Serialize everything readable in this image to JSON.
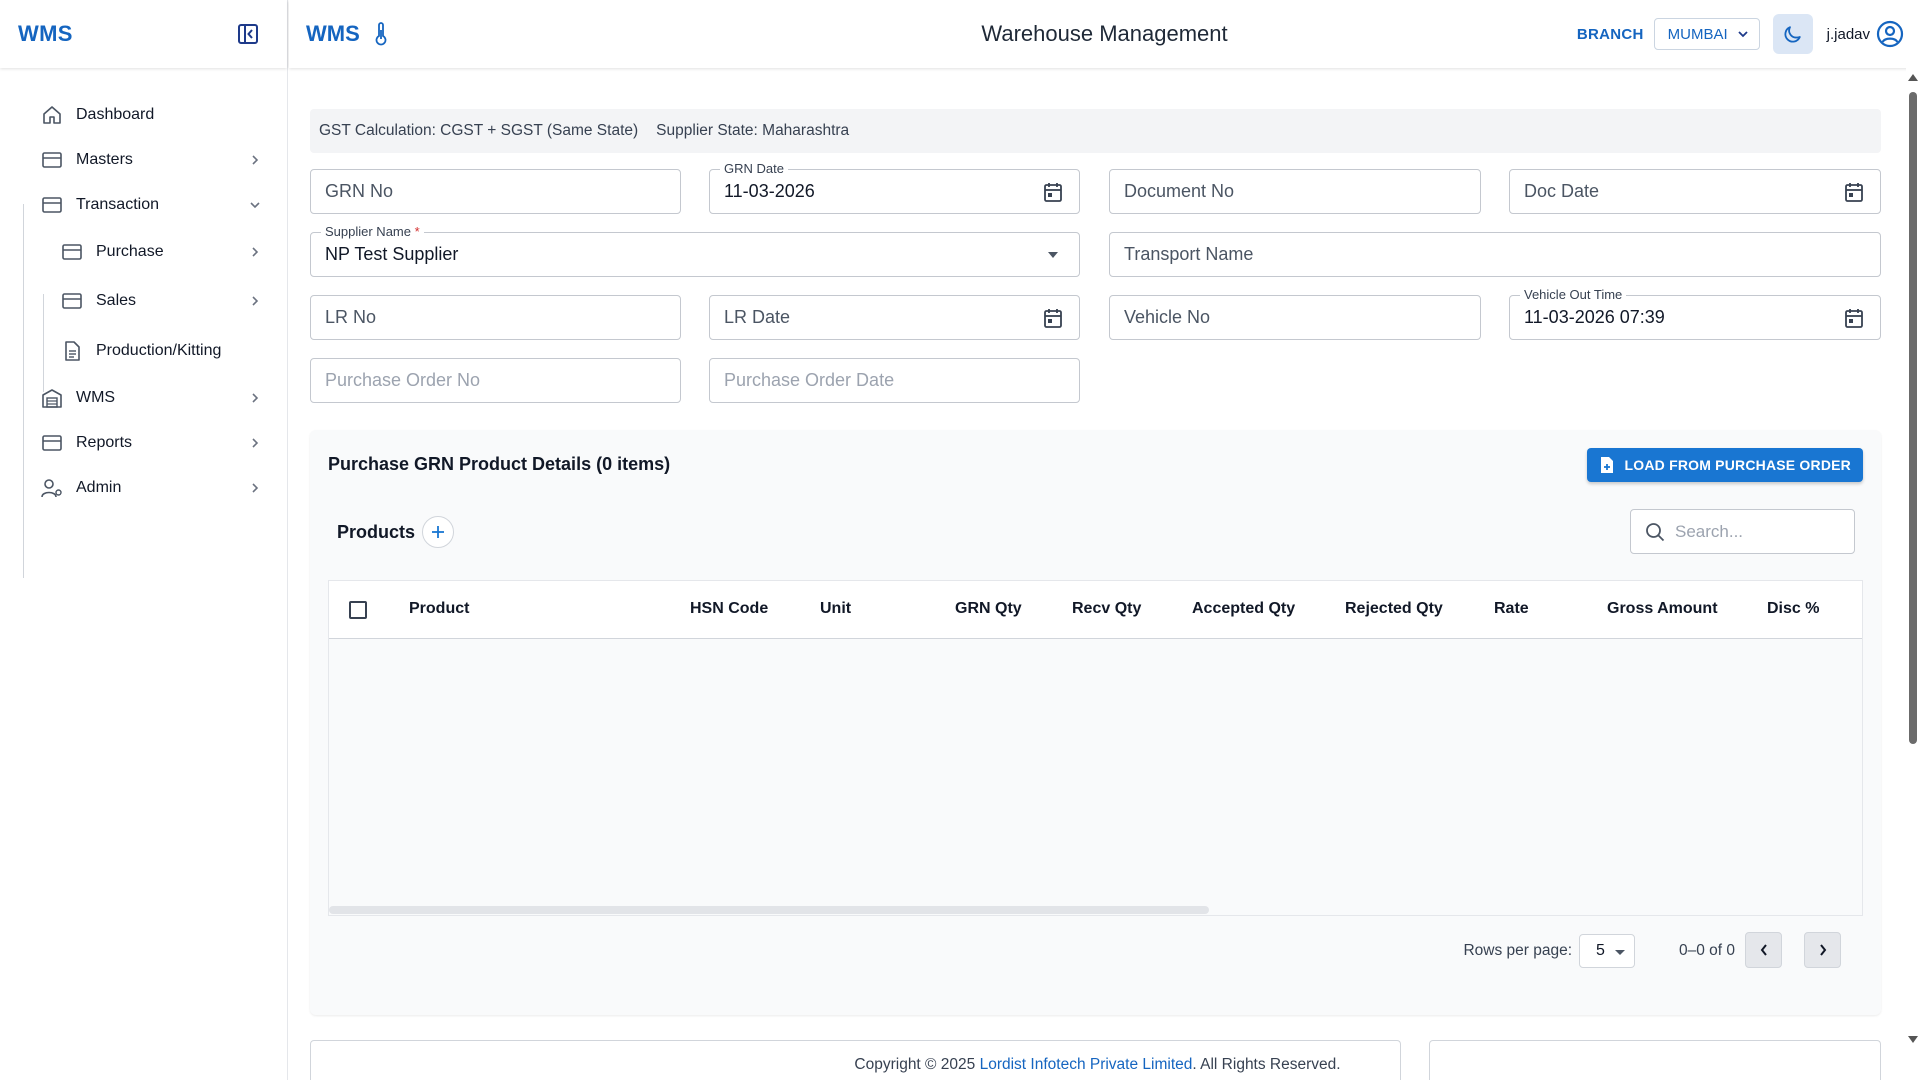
{
  "app": {
    "sidebar_logo": "WMS",
    "topbar_logo": "WMS",
    "page_title": "Warehouse Management",
    "branch_label": "BRANCH",
    "branch_value": "MUMBAI",
    "username": "j.jadav",
    "accent_color": "#1565c0"
  },
  "sidebar": {
    "items": [
      {
        "label": "Dashboard",
        "icon": "home-icon"
      },
      {
        "label": "Masters",
        "icon": "card-icon"
      },
      {
        "label": "Transaction",
        "icon": "card-icon"
      },
      {
        "label": "Purchase",
        "icon": "card-icon"
      },
      {
        "label": "Sales",
        "icon": "card-icon"
      },
      {
        "label": "Production/Kitting",
        "icon": "document-icon"
      },
      {
        "label": "WMS",
        "icon": "warehouse-icon"
      },
      {
        "label": "Reports",
        "icon": "card-icon"
      },
      {
        "label": "Admin",
        "icon": "user-gear-icon"
      }
    ]
  },
  "gst": {
    "calculation": "GST Calculation: CGST + SGST (Same State)",
    "supplier_state": "Supplier State: Maharashtra"
  },
  "form": {
    "grn_no": {
      "placeholder": "GRN No"
    },
    "grn_date": {
      "label": "GRN Date",
      "value": "11-03-2026"
    },
    "document_no": {
      "placeholder": "Document No"
    },
    "doc_date": {
      "placeholder": "Doc Date"
    },
    "supplier_name": {
      "label": "Supplier Name",
      "required_mark": "*",
      "value": "NP Test Supplier"
    },
    "transport_name": {
      "placeholder": "Transport Name"
    },
    "lr_no": {
      "placeholder": "LR No"
    },
    "lr_date": {
      "placeholder": "LR Date"
    },
    "vehicle_no": {
      "placeholder": "Vehicle No"
    },
    "vehicle_out_time": {
      "label": "Vehicle Out Time",
      "value": "11-03-2026 07:39"
    },
    "purchase_order_no": {
      "placeholder": "Purchase Order No"
    },
    "purchase_order_date": {
      "placeholder": "Purchase Order Date"
    }
  },
  "products_panel": {
    "title": "Purchase GRN Product Details (0 items)",
    "load_button": "LOAD FROM PURCHASE ORDER",
    "products_label": "Products",
    "search_placeholder": "Search...",
    "columns": [
      "Product",
      "HSN Code",
      "Unit",
      "GRN Qty",
      "Recv Qty",
      "Accepted Qty",
      "Rejected Qty",
      "Rate",
      "Gross Amount",
      "Disc %"
    ],
    "rows": [],
    "rows_per_page_label": "Rows per page:",
    "rows_per_page": "5",
    "range": "0–0 of 0"
  },
  "footer": {
    "prefix": "Copyright © 2025 ",
    "company": "Lordist Infotech Private Limited",
    "suffix": ". All Rights Reserved."
  }
}
